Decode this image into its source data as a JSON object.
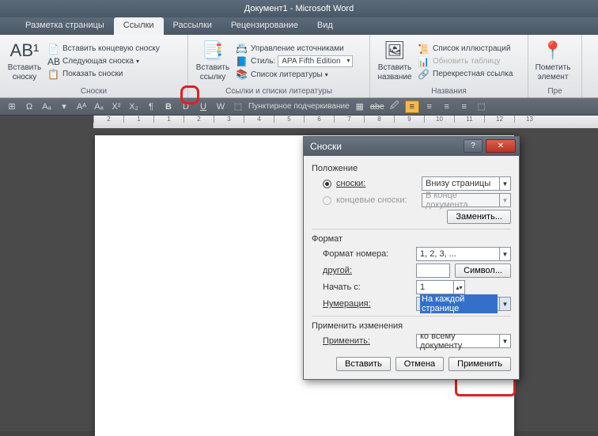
{
  "title": "Документ1 - Microsoft Word",
  "tabs": {
    "layout": "Разметка страницы",
    "links": "Ссылки",
    "mailings": "Рассылки",
    "review": "Рецензирование",
    "view": "Вид"
  },
  "ribbon": {
    "footnotes": {
      "label": "Сноски",
      "insert": "Вставить\nсноску",
      "insert_end": "Вставить концевую сноску",
      "next": "Следующая сноска",
      "show": "Показать сноски"
    },
    "citations": {
      "label": "Ссылки и списки литературы",
      "insert_link": "Вставить\nссылку",
      "manage": "Управление источниками",
      "style_lbl": "Стиль:",
      "style_val": "APA Fifth Edition",
      "bibliography": "Список литературы"
    },
    "captions": {
      "label": "Названия",
      "insert_caption": "Вставить\nназвание",
      "list_illus": "Список иллюстраций",
      "update_table": "Обновить таблицу",
      "cross_ref": "Перекрестная ссылка"
    },
    "mark": {
      "label": "Пре",
      "mark_entry": "Пометить\nэлемент"
    }
  },
  "toolbar": {
    "dashed_underline": "Пунктирное подчеркивание"
  },
  "ruler": [
    "2",
    "1",
    "",
    "1",
    "2",
    "3",
    "4",
    "5",
    "6",
    "7",
    "8",
    "9",
    "10",
    "11",
    "12",
    "13"
  ],
  "dialog": {
    "title": "Сноски",
    "position_label": "Положение",
    "footnotes_lbl": "сноски:",
    "footnotes_val": "Внизу страницы",
    "endnotes_lbl": "концевые сноски:",
    "endnotes_val": "В конце документа",
    "replace_btn": "Заменить...",
    "format_label": "Формат",
    "number_format_lbl": "Формат номера:",
    "number_format_val": "1, 2, 3, ...",
    "other_lbl": "другой:",
    "other_val": "",
    "symbol_btn": "Символ...",
    "start_at_lbl": "Начать с:",
    "start_at_val": "1",
    "numbering_lbl": "Нумерация:",
    "numbering_val": "На каждой странице",
    "apply_changes_label": "Применить изменения",
    "apply_to_lbl": "Применить:",
    "apply_to_val": "ко всему документу",
    "insert_btn": "Вставить",
    "cancel_btn": "Отмена",
    "apply_btn": "Применить"
  }
}
